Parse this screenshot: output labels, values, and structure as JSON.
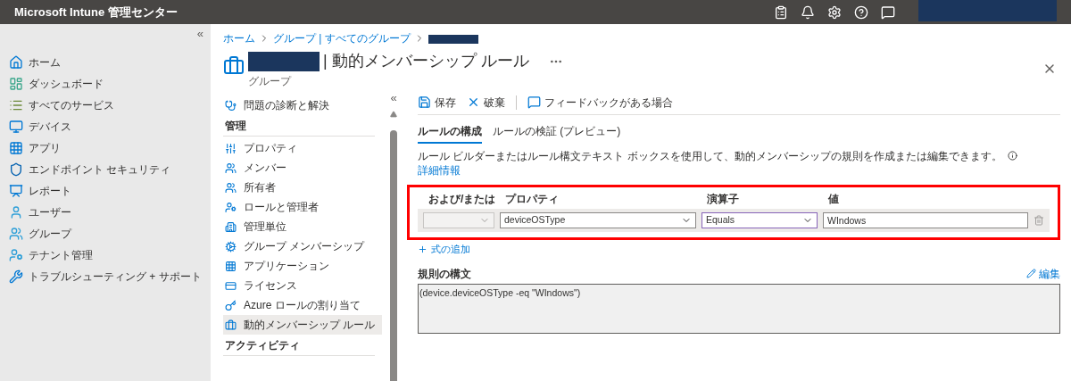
{
  "topbar": {
    "title": "Microsoft Intune 管理センター"
  },
  "nav": {
    "collapse": "«",
    "items": [
      {
        "label": "ホーム"
      },
      {
        "label": "ダッシュボード"
      },
      {
        "label": "すべてのサービス"
      },
      {
        "label": "デバイス"
      },
      {
        "label": "アプリ"
      },
      {
        "label": "エンドポイント セキュリティ"
      },
      {
        "label": "レポート"
      },
      {
        "label": "ユーザー"
      },
      {
        "label": "グループ"
      },
      {
        "label": "テナント管理"
      },
      {
        "label": "トラブルシューティング + サポート"
      }
    ]
  },
  "breadcrumb": [
    "ホーム",
    "グループ | すべてのグループ"
  ],
  "header": {
    "title": "| 動的メンバーシップ ルール",
    "subtitle": "グループ"
  },
  "menu": {
    "collapse": "«",
    "items": [
      {
        "kind": "item",
        "label": "問題の診断と解決",
        "selected": false
      },
      {
        "kind": "heading",
        "label": "管理"
      },
      {
        "kind": "item",
        "label": "プロパティ",
        "selected": false
      },
      {
        "kind": "item",
        "label": "メンバー",
        "selected": false
      },
      {
        "kind": "item",
        "label": "所有者",
        "selected": false
      },
      {
        "kind": "item",
        "label": "ロールと管理者",
        "selected": false
      },
      {
        "kind": "item",
        "label": "管理単位",
        "selected": false
      },
      {
        "kind": "item",
        "label": "グループ メンバーシップ",
        "selected": false
      },
      {
        "kind": "item",
        "label": "アプリケーション",
        "selected": false
      },
      {
        "kind": "item",
        "label": "ライセンス",
        "selected": false
      },
      {
        "kind": "item",
        "label": "Azure ロールの割り当て",
        "selected": false
      },
      {
        "kind": "item",
        "label": "動的メンバーシップ ルール",
        "selected": true
      },
      {
        "kind": "heading",
        "label": "アクティビティ"
      }
    ]
  },
  "toolbar": [
    "保存",
    "破棄",
    "フィードバックがある場合"
  ],
  "tabs": [
    {
      "label": "ルールの構成",
      "selected": true
    },
    {
      "label": "ルールの検証 (プレビュー)",
      "selected": false
    }
  ],
  "description": "ルール ビルダーまたはルール構文テキスト ボックスを使用して、動的メンバーシップの規則を作成または編集できます。",
  "more_info": "詳細情報",
  "rule_table": {
    "columns": [
      "および/または",
      "プロパティ",
      "演算子",
      "値"
    ],
    "rows": [
      {
        "property": "deviceOSType",
        "operator": "Equals",
        "value": "WIndows"
      }
    ]
  },
  "add_expression": "式の追加",
  "syntax": {
    "label": "規則の構文",
    "edit": "編集",
    "text": "(device.deviceOSType -eq \"WIndows\")"
  }
}
